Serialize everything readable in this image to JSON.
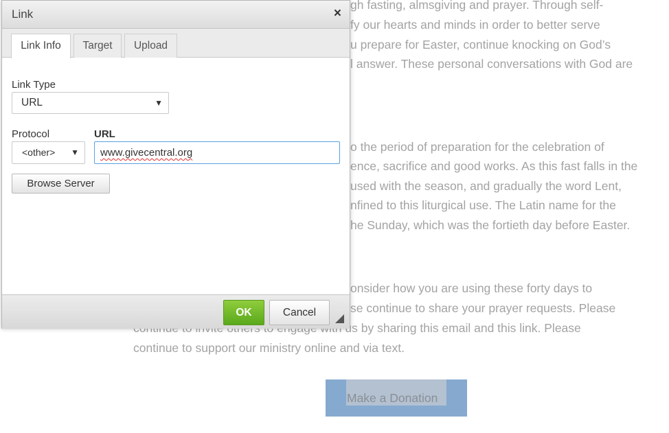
{
  "background": {
    "lines": [
      "gh fasting, almsgiving and prayer. Through self-",
      "fy our hearts and minds in order to better serve",
      "u prepare for Easter, continue knocking on God’s",
      "l answer. These personal conversations with God are",
      "o the period of preparation for the celebration of",
      "ence, sacrifice and good works. As this fast falls in the",
      "used with the season, and gradually the word Lent,",
      "nfined to this liturgical use. The Latin name for the",
      "he Sunday, which was the fortieth day before Easter.",
      "onsider how you are using these forty days to",
      "se continue to share your prayer requests. Please",
      "continue to invite others to engage with us by sharing this email and this link. Please",
      "continue to support our ministry online and via text."
    ],
    "donate_label": "Make a Donation"
  },
  "dialog": {
    "title": "Link",
    "close_icon": "×",
    "tabs": [
      "Link Info",
      "Target",
      "Upload"
    ],
    "link_type_label": "Link Type",
    "link_type_value": "URL",
    "protocol_label": "Protocol",
    "protocol_value": "<other>",
    "url_label": "URL",
    "url_value": "www.givecentral.org",
    "browse_label": "Browse Server",
    "ok_label": "OK",
    "cancel_label": "Cancel",
    "colors": {
      "ok": "#6bb82a",
      "focus": "#5aa0e0"
    }
  }
}
